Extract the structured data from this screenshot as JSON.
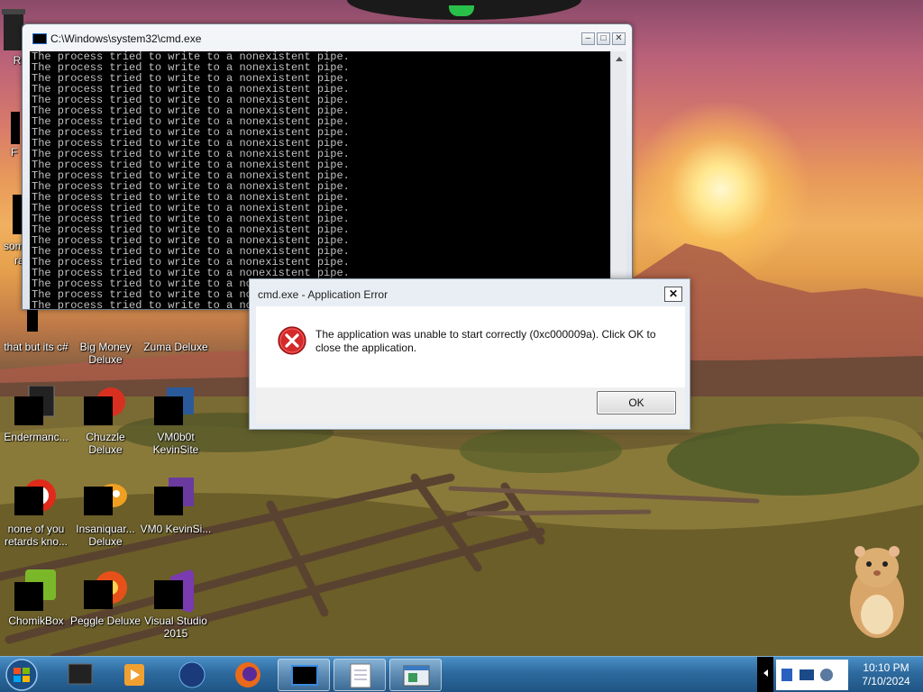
{
  "cmd_window": {
    "title": "C:\\Windows\\system32\\cmd.exe",
    "lines": [
      "The process tried to write to a nonexistent pipe.",
      "The process tried to write to a nonexistent pipe.",
      "The process tried to write to a nonexistent pipe.",
      "The process tried to write to a nonexistent pipe.",
      "The process tried to write to a nonexistent pipe.",
      "The process tried to write to a nonexistent pipe.",
      "The process tried to write to a nonexistent pipe.",
      "The process tried to write to a nonexistent pipe.",
      "The process tried to write to a nonexistent pipe.",
      "The process tried to write to a nonexistent pipe.",
      "The process tried to write to a nonexistent pipe.",
      "The process tried to write to a nonexistent pipe.",
      "The process tried to write to a nonexistent pipe.",
      "The process tried to write to a nonexistent pipe.",
      "The process tried to write to a nonexistent pipe.",
      "The process tried to write to a nonexistent pipe.",
      "The process tried to write to a nonexistent pipe.",
      "The process tried to write to a nonexistent pipe.",
      "The process tried to write to a nonexistent pipe.",
      "The process tried to write to a nonexistent pipe.",
      "The process tried to write to a nonexistent pipe.",
      "The process tried to write to a nonexistent pipe.",
      "The process tried to write to a nonexistent pipe.",
      "The process tried to write to a nonexistent pipe.",
      "The process tried to write to a nonexistent pipe.",
      "The process tried to write to a nonexistent pipe.",
      "The process tried to write to a nonexistent pipe."
    ]
  },
  "dialog": {
    "title": "cmd.exe - Application Error",
    "close_label": "✕",
    "message": "The application was unable to start correctly (0xc000009a). Click OK to close the application.",
    "ok_label": "OK"
  },
  "desktop": {
    "partial_labels": {
      "re": "Re",
      "f": "F",
      "som": "som",
      "ra": "ra"
    },
    "icons": {
      "that_but": "that but its c#",
      "big_money": "Big Money Deluxe",
      "zuma": "Zuma Deluxe",
      "endermanc": "Endermanc...",
      "chuzzle": "Chuzzle Deluxe",
      "vm0b0t": "VM0b0t KevinSite",
      "none_of_you": "none of you retards kno...",
      "insaniquarium": "Insaniquar... Deluxe",
      "vm0": "VM0 KevinSi...",
      "chomikbox": "ChomikBox",
      "peggle": "Peggle Deluxe",
      "visual_studio": "Visual Studio 2015"
    }
  },
  "taskbar": {
    "clock_time": "10:10 PM",
    "clock_date": "7/10/2024"
  },
  "colors": {
    "taskbar": "#2e6a9e",
    "error_red": "#d42a2a",
    "console_text": "#c0c0c0"
  }
}
